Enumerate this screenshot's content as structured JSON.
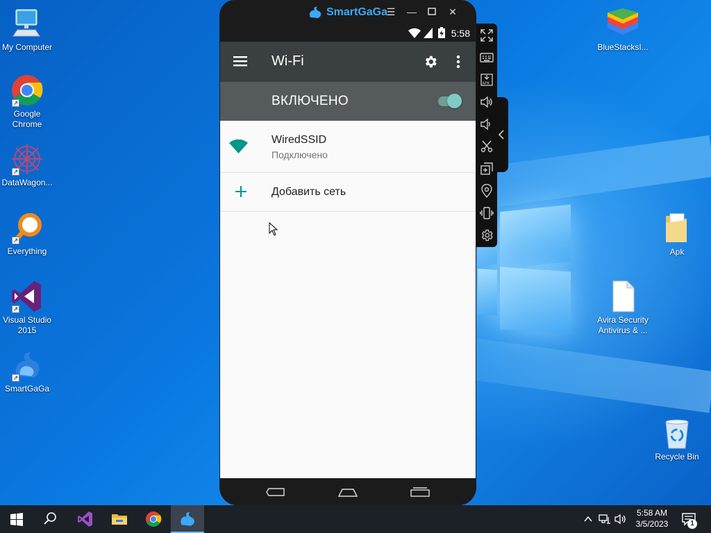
{
  "desktop": {
    "icons_left": [
      {
        "label": "My Computer",
        "icon": "computer-icon"
      },
      {
        "label": "Google Chrome",
        "icon": "chrome-icon"
      },
      {
        "label": "DataWagon...",
        "icon": "datawagon-icon"
      },
      {
        "label": "Everything",
        "icon": "everything-search-icon"
      },
      {
        "label": "Visual Studio 2015",
        "icon": "visual-studio-icon"
      },
      {
        "label": "SmartGaGa",
        "icon": "smartgaga-icon"
      }
    ],
    "icons_right": [
      {
        "label": "BlueStacksI...",
        "icon": "bluestacks-icon"
      },
      {
        "label": "Apk",
        "icon": "folder-icon"
      },
      {
        "label": "Avira Security Antivirus & ...",
        "icon": "file-icon"
      },
      {
        "label": "Recycle Bin",
        "icon": "recycle-bin-icon"
      }
    ]
  },
  "emulator": {
    "title": "SmartGaGa",
    "controls": [
      "menu-icon",
      "minimize-icon",
      "maximize-icon",
      "close-icon"
    ],
    "status_time": "5:58",
    "sidebar_icons": [
      "fullscreen-icon",
      "keyboard-icon",
      "apk-install-icon",
      "volume-up-icon",
      "volume-down-icon",
      "screenshot-scissors-icon",
      "multi-instance-icon",
      "location-icon",
      "shake-icon",
      "settings-gear-icon"
    ]
  },
  "android": {
    "appbar": {
      "title": "Wi-Fi"
    },
    "toggle": {
      "label": "ВКЛЮЧЕНО",
      "on": true
    },
    "network": {
      "name": "WiredSSID",
      "status": "Подключено"
    },
    "add_network": {
      "label": "Добавить сеть"
    },
    "colors": {
      "appbar": "#3a3f41",
      "toggle_row": "#555a5c",
      "accent": "#009688"
    }
  },
  "taskbar": {
    "items": [
      "windows-start-icon",
      "search-icon",
      "visual-studio-icon",
      "file-explorer-icon",
      "chrome-icon",
      "smartgaga-icon"
    ],
    "clock_time": "5:58 AM",
    "clock_date": "3/5/2023",
    "notification_count": "1"
  }
}
